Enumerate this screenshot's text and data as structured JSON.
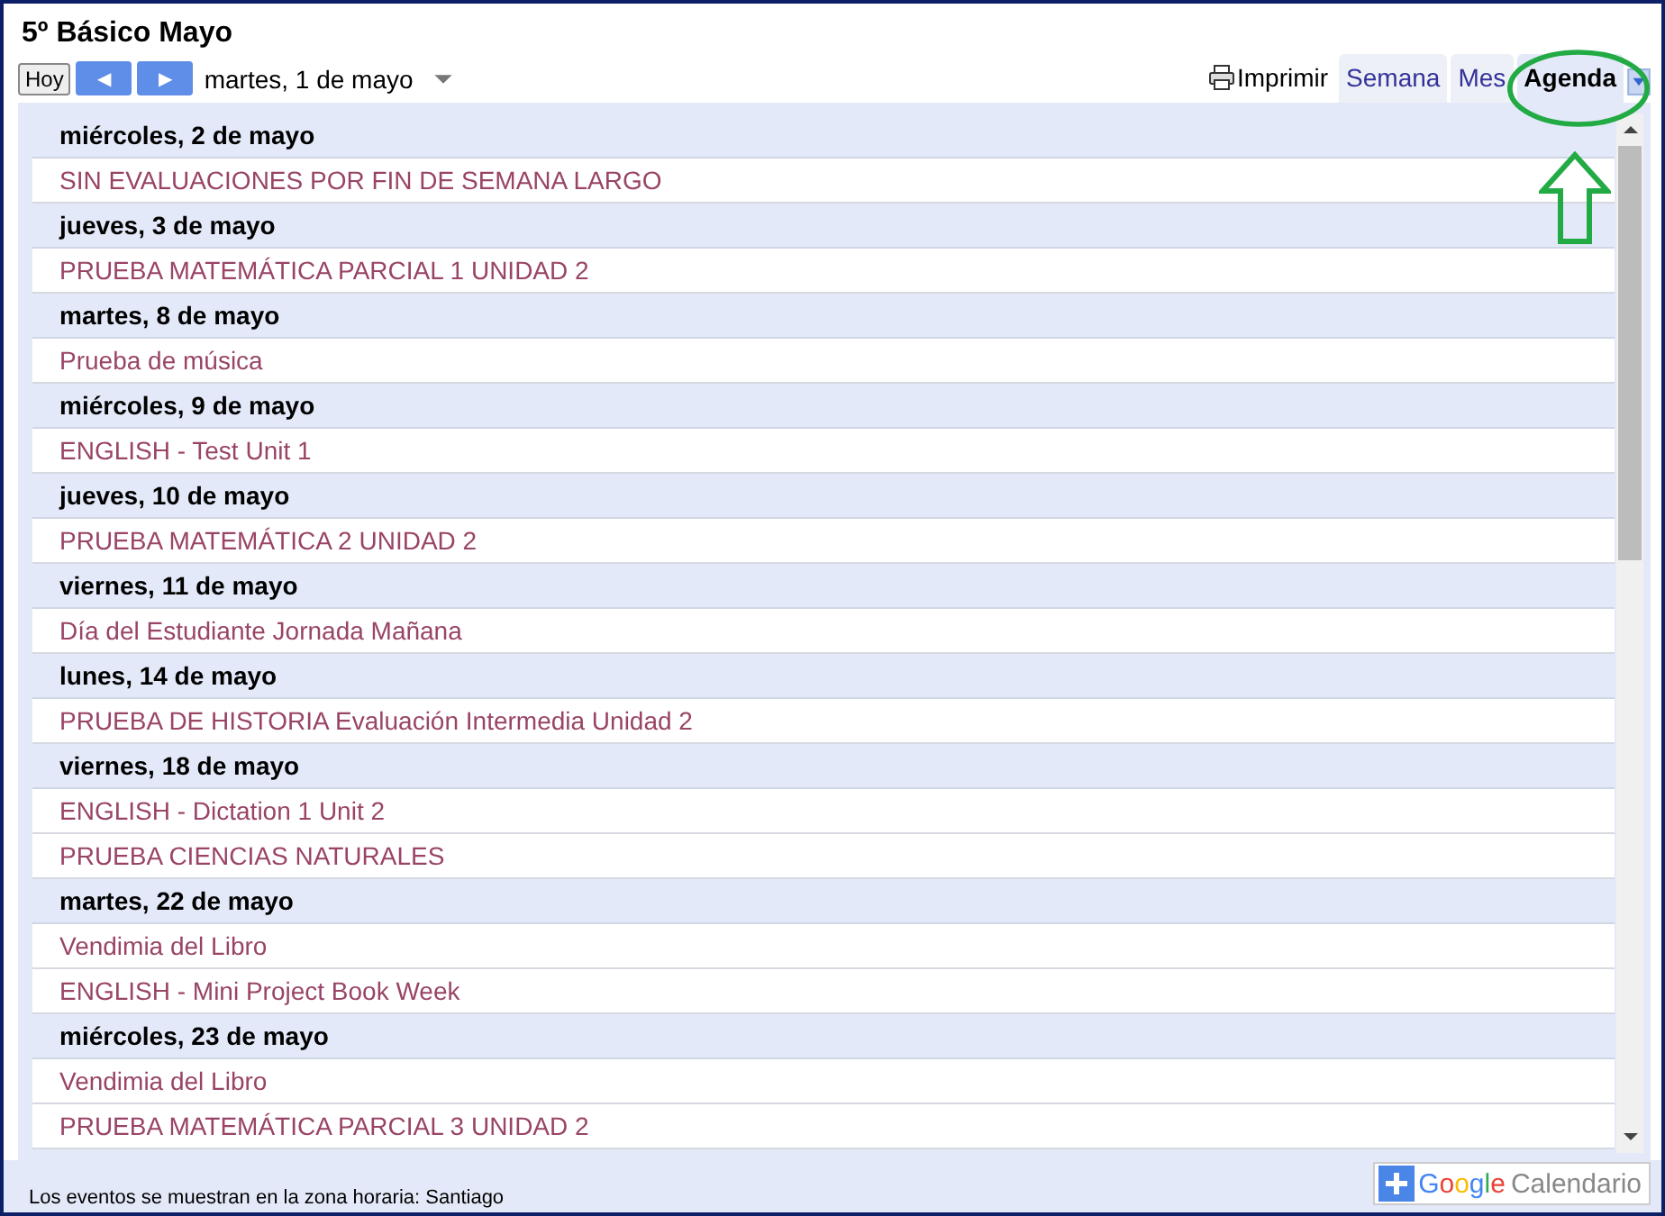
{
  "title": "5º Básico Mayo",
  "toolbar": {
    "today": "Hoy",
    "prev": "◀",
    "next": "▶",
    "date": "martes, 1 de mayo",
    "print": "Imprimir"
  },
  "tabs": [
    {
      "label": "Semana",
      "selected": false
    },
    {
      "label": "Mes",
      "selected": false
    },
    {
      "label": "Agenda",
      "selected": true
    }
  ],
  "agenda": [
    {
      "date": "miércoles, 2 de mayo",
      "events": [
        "SIN EVALUACIONES POR FIN DE SEMANA LARGO"
      ]
    },
    {
      "date": "jueves, 3 de mayo",
      "events": [
        "PRUEBA MATEMÁTICA PARCIAL 1 UNIDAD 2"
      ]
    },
    {
      "date": "martes, 8 de mayo",
      "events": [
        "Prueba de música"
      ]
    },
    {
      "date": "miércoles, 9 de mayo",
      "events": [
        "ENGLISH - Test Unit 1"
      ]
    },
    {
      "date": "jueves, 10 de mayo",
      "events": [
        "PRUEBA MATEMÁTICA 2 UNIDAD 2"
      ]
    },
    {
      "date": "viernes, 11 de mayo",
      "events": [
        "Día del Estudiante Jornada Mañana"
      ]
    },
    {
      "date": "lunes, 14 de mayo",
      "events": [
        "PRUEBA DE HISTORIA Evaluación Intermedia Unidad 2"
      ]
    },
    {
      "date": "viernes, 18 de mayo",
      "events": [
        "ENGLISH - Dictation 1 Unit 2",
        "PRUEBA CIENCIAS NATURALES"
      ]
    },
    {
      "date": "martes, 22 de mayo",
      "events": [
        "Vendimia del Libro",
        "ENGLISH - Mini Project Book Week"
      ]
    },
    {
      "date": "miércoles, 23 de mayo",
      "events": [
        "Vendimia del Libro",
        "PRUEBA MATEMÁTICA PARCIAL 3 UNIDAD 2"
      ]
    }
  ],
  "footer": {
    "timezone": "Los eventos se muestran en la zona horaria: Santiago",
    "brand": "Google",
    "product": "Calendario"
  }
}
